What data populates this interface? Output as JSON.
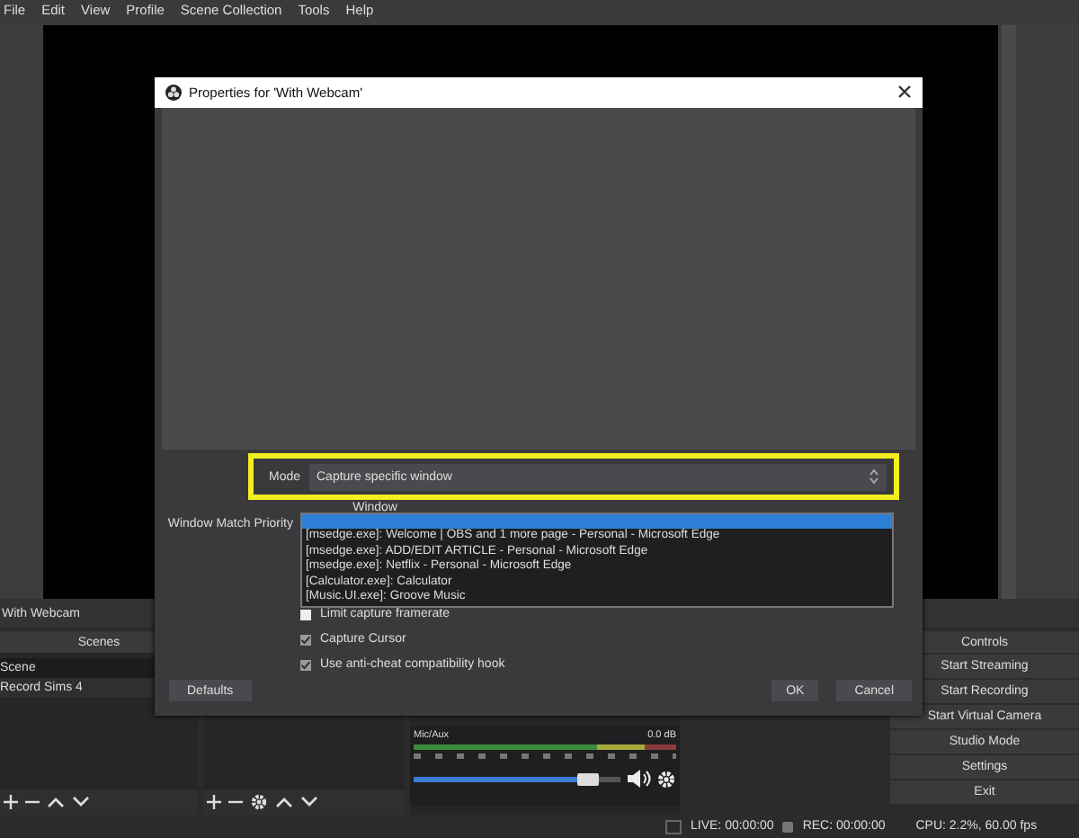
{
  "menu": [
    "File",
    "Edit",
    "View",
    "Profile",
    "Scene Collection",
    "Tools",
    "Help"
  ],
  "scene_title": "With Webcam",
  "scenes": {
    "title": "Scenes",
    "items": [
      {
        "label": "Scene",
        "selected": true
      },
      {
        "label": "Record Sims 4",
        "selected": false
      }
    ]
  },
  "mixer": {
    "channel": "Mic/Aux",
    "reading": "0.0 dB",
    "level": 0.85
  },
  "controls": {
    "title": "Controls",
    "buttons": [
      "Start Streaming",
      "Start Recording",
      "Start Virtual Camera",
      "Studio Mode",
      "Settings",
      "Exit"
    ]
  },
  "status_bar": {
    "live": "LIVE: 00:00:00",
    "rec": "REC: 00:00:00",
    "cpu": "CPU: 2.2%, 60.00 fps"
  },
  "dialog": {
    "title": "Properties for 'With Webcam'",
    "mode": {
      "label": "Mode",
      "value": "Capture specific window",
      "highlighted": true
    },
    "window_label": "Window",
    "priority_label": "Window Match Priority",
    "window_list": {
      "blank_row_highlighted": true,
      "items": [
        {
          "label": "[msedge.exe]: Welcome | OBS and 1 more page - Personal - Microsoft Edge",
          "selected": false
        },
        {
          "label": "[msedge.exe]: ADD/EDIT ARTICLE - Personal - Microsoft Edge",
          "selected": false
        },
        {
          "label": "[msedge.exe]: Netflix - Personal - Microsoft Edge",
          "selected": false
        },
        {
          "label": "[Calculator.exe]: Calculator",
          "selected": false
        },
        {
          "label": "[Music.UI.exe]: Groove Music",
          "selected": false
        }
      ]
    },
    "checkboxes": [
      {
        "label": "Limit capture framerate",
        "checked": false
      },
      {
        "label": "Capture Cursor",
        "checked": true
      },
      {
        "label": "Use anti-cheat compatibility hook",
        "checked": true
      }
    ],
    "defaults_button": "Defaults",
    "ok_button": "OK",
    "cancel_button": "Cancel"
  }
}
